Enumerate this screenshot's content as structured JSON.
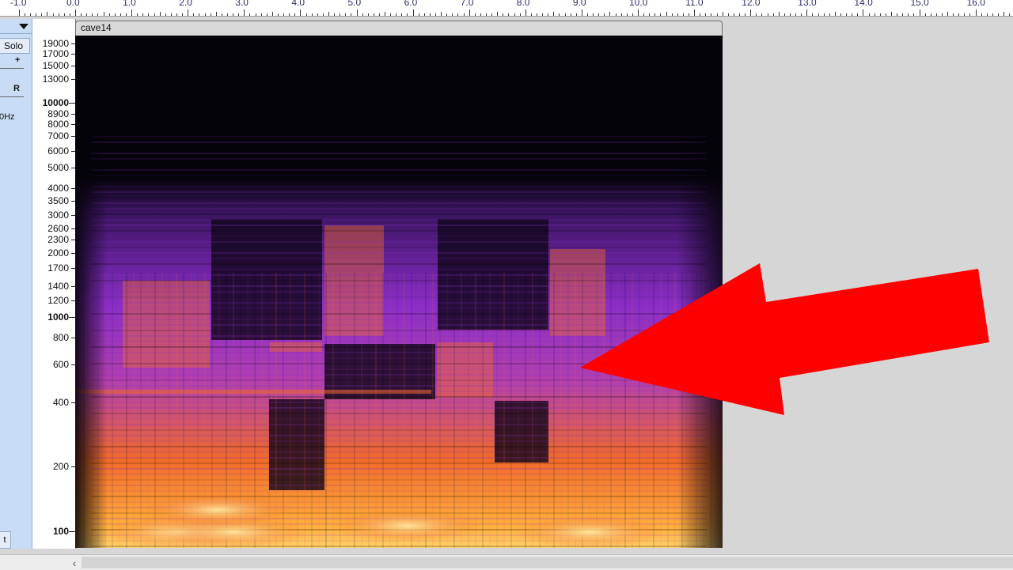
{
  "timeline": {
    "labels": [
      "-1.0",
      "0.0",
      "1.0",
      "2.0",
      "3.0",
      "4.0",
      "5.0",
      "6.0",
      "7.0",
      "8.0",
      "9.0",
      "10.0",
      "11.0",
      "12.0",
      "13.0",
      "14.0",
      "15.0",
      "16.0"
    ],
    "values": [
      -1,
      0,
      1,
      2,
      3,
      4,
      5,
      6,
      7,
      8,
      9,
      10,
      11,
      12,
      13,
      14,
      15,
      16
    ]
  },
  "track_panel": {
    "solo_label": "Solo",
    "plus_label": "+",
    "right_label": "R",
    "rate_label": "0Hz",
    "select_label": "t"
  },
  "clip": {
    "name": "cave14"
  },
  "frequency_scale": {
    "labels": [
      "19000",
      "17000",
      "15000",
      "13000",
      "10000",
      "8900",
      "8000",
      "7000",
      "6000",
      "5000",
      "4000",
      "3500",
      "3000",
      "2600",
      "2300",
      "2000",
      "1700",
      "1400",
      "1200",
      "1000",
      "800",
      "600",
      "400",
      "200",
      "100"
    ],
    "values": [
      19000,
      17000,
      15000,
      13000,
      10000,
      8900,
      8000,
      7000,
      6000,
      5000,
      4000,
      3500,
      3000,
      2600,
      2300,
      2000,
      1700,
      1400,
      1200,
      1000,
      800,
      600,
      400,
      200,
      100
    ],
    "major": [
      "10000",
      "1000",
      "100"
    ]
  },
  "spectrogram": {
    "colors": {
      "background": "#05030a",
      "low": "#3a1460",
      "mid": "#8a2ec8",
      "high": "#f06a2a",
      "peak": "#ffe9a0"
    }
  },
  "annotation": {
    "arrow_color": "#ff0000"
  },
  "scrollbar": {
    "left_arrow": "‹"
  }
}
